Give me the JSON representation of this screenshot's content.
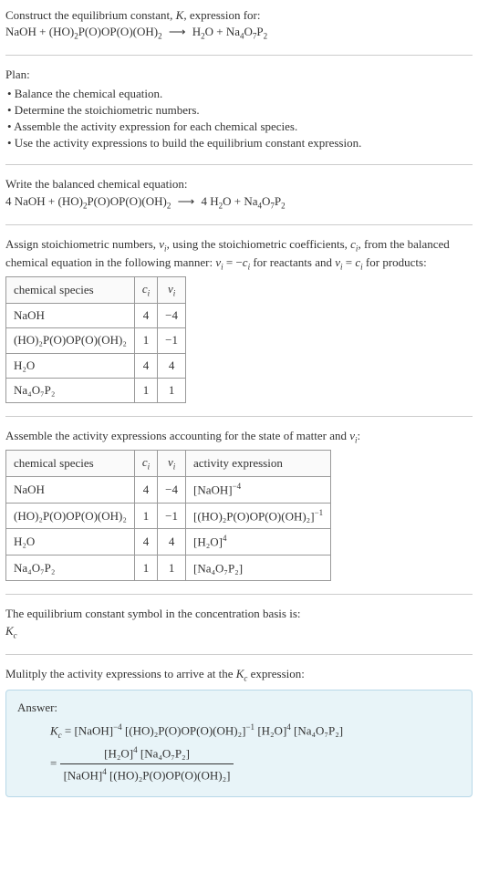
{
  "intro": {
    "line1": "Construct the equilibrium constant, ",
    "K": "K",
    "line1b": ", expression for:",
    "eq_lhs1": "NaOH + (HO)",
    "eq_lhs2": "P(O)OP(O)(OH)",
    "arrow": "⟶",
    "eq_rhs1": "H",
    "eq_rhs2": "O + Na",
    "eq_rhs3": "O",
    "eq_rhs4": "P"
  },
  "plan": {
    "title": "Plan:",
    "items": [
      "• Balance the chemical equation.",
      "• Determine the stoichiometric numbers.",
      "• Assemble the activity expression for each chemical species.",
      "• Use the activity expressions to build the equilibrium constant expression."
    ]
  },
  "balanced": {
    "title": "Write the balanced chemical equation:",
    "c1": "4 NaOH + (HO)",
    "c2": "P(O)OP(O)(OH)",
    "arrow": "⟶",
    "c3": "4 H",
    "c4": "O + Na",
    "c5": "O",
    "c6": "P"
  },
  "assign": {
    "text1": "Assign stoichiometric numbers, ",
    "nu_i": "ν",
    "text2": ", using the stoichiometric coefficients, ",
    "c_i": "c",
    "text3": ", from the balanced chemical equation in the following manner: ",
    "eq1a": "ν",
    "eq1b": " = −",
    "eq1c": "c",
    "text4": " for reactants and ",
    "eq2a": "ν",
    "eq2b": " = ",
    "eq2c": "c",
    "text5": " for products:"
  },
  "table1": {
    "headers": {
      "h1": "chemical species",
      "h2": "c",
      "h3": "ν"
    },
    "rows": [
      {
        "sp": "NaOH",
        "c": "4",
        "v": "−4"
      },
      {
        "sp": "(HO)₂P(O)OP(O)(OH)₂",
        "c": "1",
        "v": "−1"
      },
      {
        "sp": "H₂O",
        "c": "4",
        "v": "4"
      },
      {
        "sp": "Na₄O₇P₂",
        "c": "1",
        "v": "1"
      }
    ]
  },
  "assemble": {
    "text1": "Assemble the activity expressions accounting for the state of matter and ",
    "nu_i": "ν",
    "text2": ":"
  },
  "table2": {
    "headers": {
      "h1": "chemical species",
      "h2": "c",
      "h3": "ν",
      "h4": "activity expression"
    },
    "rows": [
      {
        "sp": "NaOH",
        "c": "4",
        "v": "−4",
        "ae_base": "[NaOH]",
        "ae_exp": "−4"
      },
      {
        "sp": "(HO)₂P(O)OP(O)(OH)₂",
        "c": "1",
        "v": "−1",
        "ae_base": "[(HO)₂P(O)OP(O)(OH)₂]",
        "ae_exp": "−1"
      },
      {
        "sp": "H₂O",
        "c": "4",
        "v": "4",
        "ae_base": "[H₂O]",
        "ae_exp": "4"
      },
      {
        "sp": "Na₄O₇P₂",
        "c": "1",
        "v": "1",
        "ae_base": "[Na₄O₇P₂]",
        "ae_exp": ""
      }
    ]
  },
  "symbol": {
    "text": "The equilibrium constant symbol in the concentration basis is:",
    "Kc": "K"
  },
  "multiply": {
    "text1": "Mulitply the activity expressions to arrive at the ",
    "Kc": "K",
    "text2": " expression:"
  },
  "answer": {
    "label": "Answer:",
    "Kc": "K",
    "eq": " = [NaOH]",
    "exp1": "−4",
    "t2": " [(HO)₂P(O)OP(O)(OH)₂]",
    "exp2": "−1",
    "t3": " [H₂O]",
    "exp3": "4",
    "t4": " [Na₄O₇P₂]",
    "eq2": " = ",
    "num": "[H₂O]",
    "num_exp": "4",
    "num2": " [Na₄O₇P₂]",
    "den": "[NaOH]",
    "den_exp": "4",
    "den2": " [(HO)₂P(O)OP(O)(OH)₂]"
  },
  "subs": {
    "two": "2",
    "four": "4",
    "seven": "7",
    "i": "i",
    "c": "c"
  }
}
